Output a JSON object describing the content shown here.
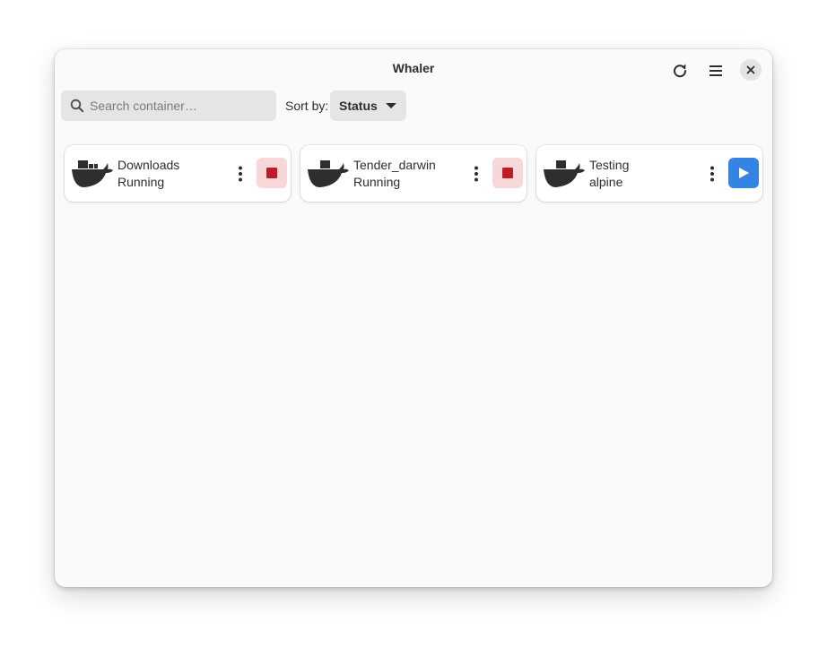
{
  "window": {
    "title": "Whaler"
  },
  "header": {
    "refresh_icon": "refresh-icon",
    "menu_icon": "hamburger-menu-icon",
    "close_icon": "close-icon"
  },
  "search": {
    "placeholder": "Search container…",
    "value": "",
    "icon": "search-icon"
  },
  "sort": {
    "label": "Sort by:",
    "selected": "Status",
    "icon": "caret-down-icon"
  },
  "containers": [
    {
      "name": "Downloads",
      "status": "Running",
      "action": "stop",
      "icon": "docker-whale-icon"
    },
    {
      "name": "Tender_darwin",
      "status": "Running",
      "action": "stop",
      "icon": "docker-whale-icon"
    },
    {
      "name": "Testing",
      "status": "alpine",
      "action": "start",
      "icon": "docker-whale-icon"
    }
  ],
  "colors": {
    "stop_bg": "#f7d7d8",
    "stop_fg": "#c01c28",
    "start_bg": "#3584e4",
    "text": "#2e2e2e"
  }
}
